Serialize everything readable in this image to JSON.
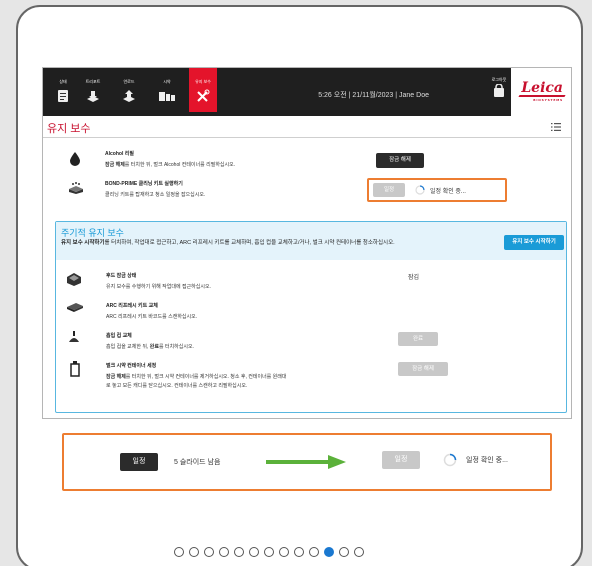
{
  "nav": {
    "items": [
      {
        "label": "상태",
        "icon": "status-icon"
      },
      {
        "label": "트리포트",
        "icon": "tray-icon"
      },
      {
        "label": "언로드",
        "icon": "unload-icon"
      },
      {
        "label": "시약",
        "icon": "reagent-icon"
      },
      {
        "label": "유지 보수",
        "icon": "maintenance-icon",
        "active": true
      }
    ],
    "status_line": "5:26 오전  |  21/11월/2023  |  Jane Doe",
    "logout_label": "로그아웃",
    "logo": "Leica",
    "logo_sub": "BIOSYSTEMS"
  },
  "page": {
    "title": "유지 보수"
  },
  "alcohol": {
    "title": "Alcohol 리필",
    "desc_bold": "잠금 해제",
    "desc_rest": "를 터치한 뒤, 벌크 Alcohol 컨테이너를 리필하십시오.",
    "button": "잠금 해제"
  },
  "bond_prime": {
    "title": "BOND-PRIME 클리닝 키트 실행하기",
    "desc": "클리닝 키트를 탑재하고 청소 일정을 잡으십시오.",
    "button": "일정",
    "spinner_text": "일정 확인 중..."
  },
  "pm": {
    "title": "주기적 유지 보수",
    "desc_bold": "유지 보수 시작하기",
    "desc_rest": "를 터치하여, 작업대로 접근하고, ARC 리프레시 키트를 교체하며, 흡입 컵을 교체하고/거나, 벌크 시약 컨테이너를 청소하십시오.",
    "start_button": "유지 보수 시작하기",
    "rows": [
      {
        "title": "후드 잠금 상태",
        "desc": "유지 보수를 수행하기 위해 작업대에 접근하십시오.",
        "value": "잠김"
      },
      {
        "title": "ARC 리프레시 키트 교체",
        "desc": "ARC 리프레시 키트 바코드를 스캔하십시오."
      },
      {
        "title": "흡입 컵 교체",
        "desc_pre": "흡입 컵을 교체한 뒤, ",
        "desc_bold": "완료",
        "desc_post": "를 터치하십시오.",
        "button": "완료"
      },
      {
        "title": "벌크 시약 컨테이너 세정",
        "desc_bold": "잠금 해제",
        "desc_rest": "를 터치한 뒤, 벌크 시약 컨테이너를 제거하십시오. 청소 후, 컨테이너를 원래대",
        "desc_line2": "로 놓고 모든 캐디를 닫으십시오. 컨테이너를 스캔하고 리필하십시오.",
        "button": "잠금 해제"
      }
    ]
  },
  "bottom": {
    "left_button": "일정",
    "slides_left": "5 슬라이드 남음",
    "right_button": "일정",
    "spinner_text": "일정 확인 중..."
  },
  "pagination": {
    "total": 13,
    "active": 11
  },
  "colors": {
    "accent": "#c8102e",
    "blue": "#1a9bd7",
    "highlight": "#ed7d31",
    "arrow": "#5bb13a"
  }
}
